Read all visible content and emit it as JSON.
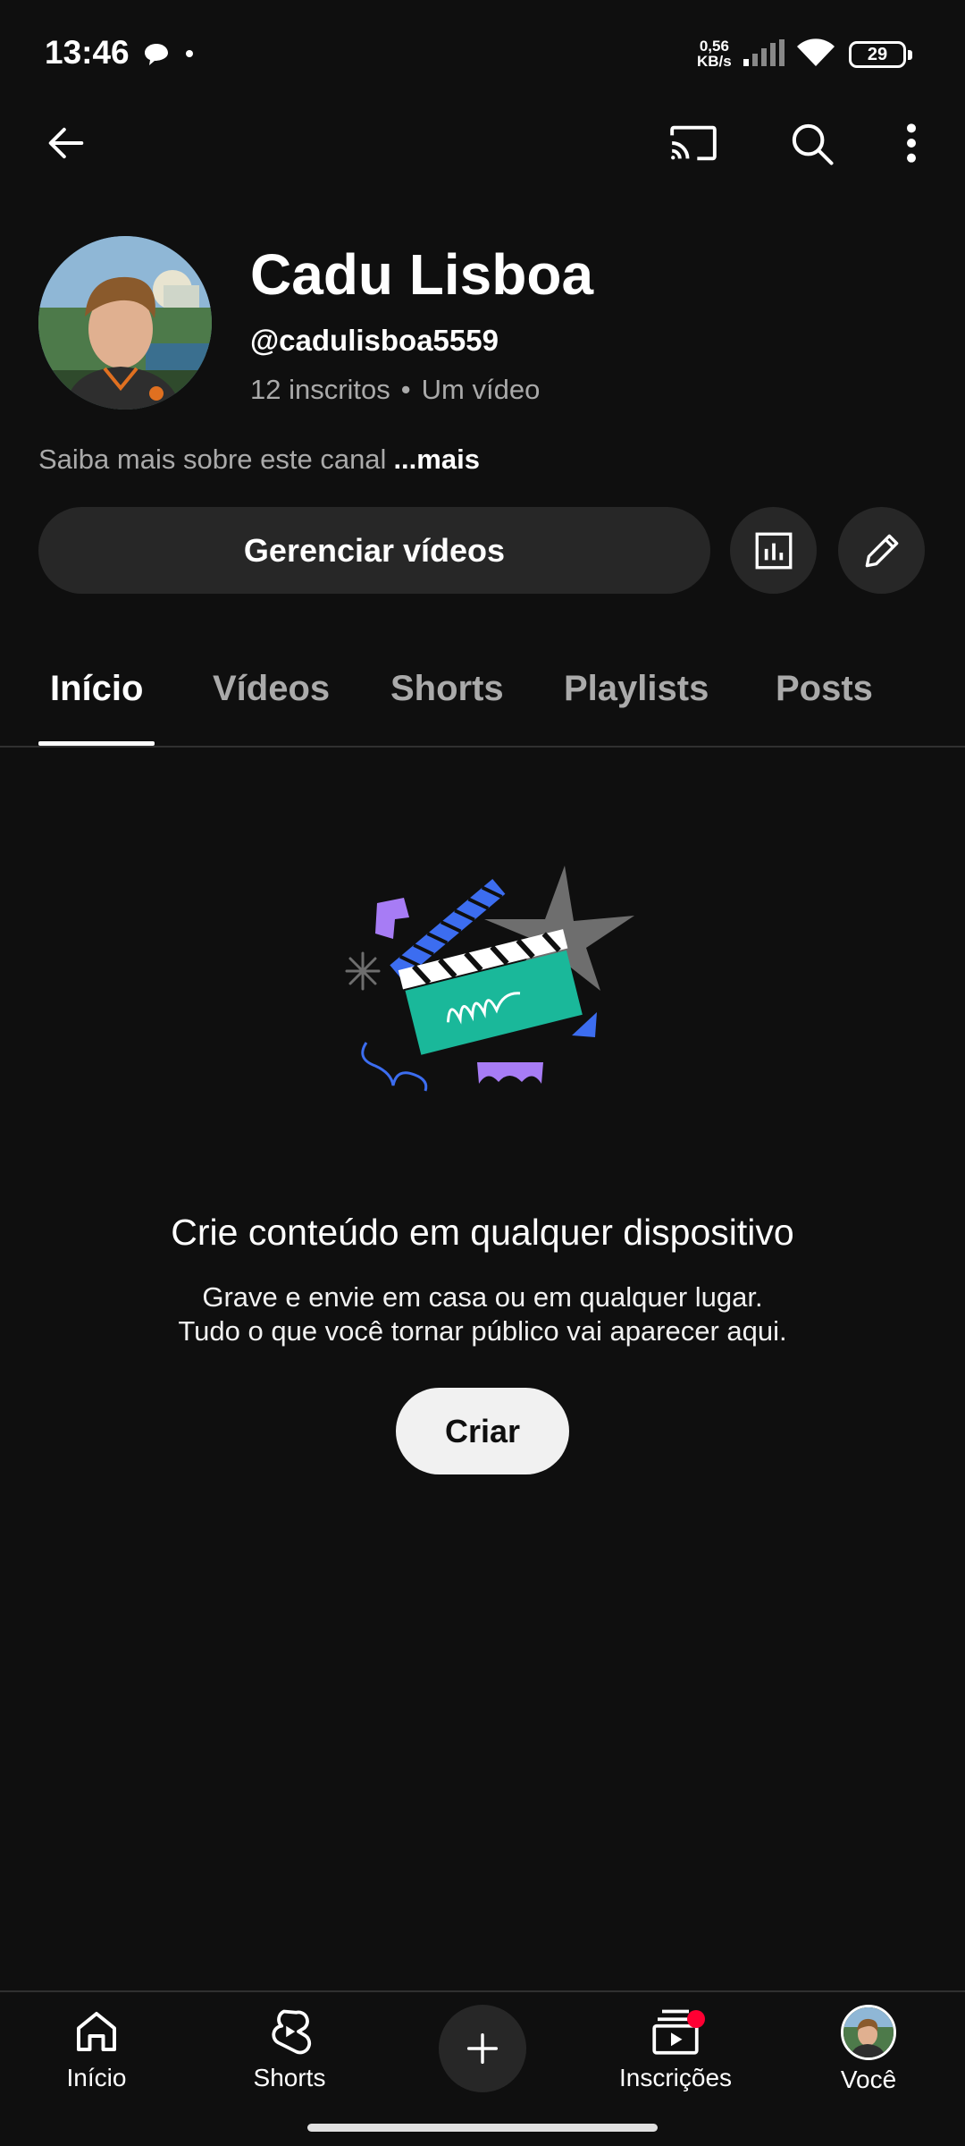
{
  "status_bar": {
    "time": "13:46",
    "speed_value": "0,56",
    "speed_unit": "KB/s",
    "battery": "29"
  },
  "app_bar": {
    "icons": [
      "back-arrow-icon",
      "cast-icon",
      "search-icon",
      "more-vert-icon"
    ]
  },
  "channel": {
    "name": "Cadu Lisboa",
    "handle": "@cadulisboa5559",
    "subscribers": "12 inscritos",
    "separator": "•",
    "videos": "Um vídeo",
    "about": "Saiba mais sobre este canal",
    "about_more": "...mais",
    "manage_button": "Gerenciar vídeos"
  },
  "tabs": [
    {
      "label": "Início",
      "active": true
    },
    {
      "label": "Vídeos",
      "active": false
    },
    {
      "label": "Shorts",
      "active": false
    },
    {
      "label": "Playlists",
      "active": false
    },
    {
      "label": "Posts",
      "active": false
    }
  ],
  "empty_state": {
    "title": "Crie conteúdo em qualquer dispositivo",
    "line1": "Grave e envie em casa ou em qualquer lugar.",
    "line2": "Tudo o que você tornar público vai aparecer aqui.",
    "button": "Criar"
  },
  "bottom_nav": {
    "items": [
      {
        "label": "Início",
        "icon": "home-icon"
      },
      {
        "label": "Shorts",
        "icon": "shorts-icon"
      },
      {
        "label": "",
        "icon": "add-icon"
      },
      {
        "label": "Inscrições",
        "icon": "subscriptions-icon"
      },
      {
        "label": "Você",
        "icon": "avatar"
      }
    ]
  },
  "colors": {
    "background": "#0f0f0f",
    "surface": "#272727",
    "text_secondary": "#aaaaaa",
    "badge": "#ff0033"
  }
}
